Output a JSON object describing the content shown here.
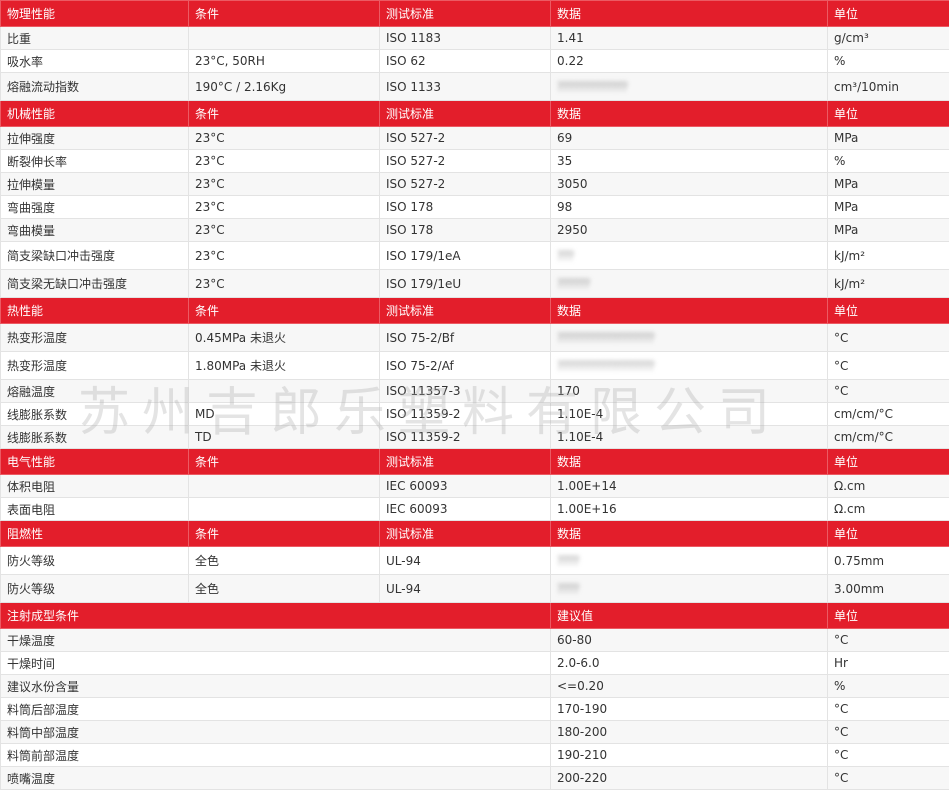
{
  "sections": [
    {
      "header": [
        "物理性能",
        "条件",
        "测试标准",
        "数据",
        "单位"
      ],
      "rows": [
        {
          "name": "比重",
          "cond": "",
          "std": "ISO 1183",
          "data": "1.41",
          "unit": "g/cm³"
        },
        {
          "name": "吸水率",
          "cond": "23°C, 50RH",
          "std": "ISO 62",
          "data": "0.22",
          "unit": "%"
        },
        {
          "name": "熔融流动指数",
          "cond": "190°C / 2.16Kg",
          "std": "ISO 1133",
          "data": "?????????????",
          "blurred": true,
          "unit": "cm³/10min",
          "tall": true
        }
      ]
    },
    {
      "header": [
        "机械性能",
        "条件",
        "测试标准",
        "数据",
        "单位"
      ],
      "rows": [
        {
          "name": "拉伸强度",
          "cond": "23°C",
          "std": "ISO 527-2",
          "data": "69",
          "unit": "MPa"
        },
        {
          "name": "断裂伸长率",
          "cond": "23°C",
          "std": "ISO 527-2",
          "data": "35",
          "unit": "%"
        },
        {
          "name": "拉伸模量",
          "cond": "23°C",
          "std": "ISO 527-2",
          "data": "3050",
          "unit": "MPa"
        },
        {
          "name": "弯曲强度",
          "cond": "23°C",
          "std": "ISO 178",
          "data": "98",
          "unit": "MPa"
        },
        {
          "name": "弯曲模量",
          "cond": "23°C",
          "std": "ISO 178",
          "data": "2950",
          "unit": "MPa"
        },
        {
          "name": "简支梁缺口冲击强度",
          "cond": "23°C",
          "std": "ISO 179/1eA",
          "data": "???",
          "blurred": true,
          "unit": "kJ/m²",
          "tall": true
        },
        {
          "name": "简支梁无缺口冲击强度",
          "cond": "23°C",
          "std": "ISO 179/1eU",
          "data": "??????",
          "blurred": true,
          "unit": "kJ/m²",
          "tall": true
        }
      ]
    },
    {
      "header": [
        "热性能",
        "条件",
        "测试标准",
        "数据",
        "单位"
      ],
      "rows": [
        {
          "name": "热变形温度",
          "cond": "0.45MPa 未退火",
          "std": "ISO 75-2/Bf",
          "data": "??????????????????",
          "blurred": true,
          "unit": "°C",
          "tall": true
        },
        {
          "name": "热变形温度",
          "cond": "1.80MPa 未退火",
          "std": "ISO 75-2/Af",
          "data": "??????????????????",
          "blurred": true,
          "unit": "°C",
          "tall": true
        },
        {
          "name": "熔融温度",
          "cond": "",
          "std": "ISO 11357-3",
          "data": "170",
          "unit": "°C"
        },
        {
          "name": "线膨胀系数",
          "cond": "MD",
          "std": "ISO 11359-2",
          "data": "1.10E-4",
          "unit": "cm/cm/°C"
        },
        {
          "name": "线膨胀系数",
          "cond": "TD",
          "std": "ISO 11359-2",
          "data": "1.10E-4",
          "unit": "cm/cm/°C"
        }
      ]
    },
    {
      "header": [
        "电气性能",
        "条件",
        "测试标准",
        "数据",
        "单位"
      ],
      "rows": [
        {
          "name": "体积电阻",
          "cond": "",
          "std": "IEC 60093",
          "data": "1.00E+14",
          "unit": "Ω.cm"
        },
        {
          "name": "表面电阻",
          "cond": "",
          "std": "IEC 60093",
          "data": "1.00E+16",
          "unit": "Ω.cm"
        }
      ]
    },
    {
      "header": [
        "阻燃性",
        "条件",
        "测试标准",
        "数据",
        "单位"
      ],
      "rows": [
        {
          "name": "防火等级",
          "cond": "全色",
          "std": "UL-94",
          "data": "????",
          "blurred": true,
          "unit": "0.75mm",
          "tall": true
        },
        {
          "name": "防火等级",
          "cond": "全色",
          "std": "UL-94",
          "data": "????",
          "blurred": true,
          "unit": "3.00mm",
          "tall": true
        }
      ]
    }
  ],
  "molding": {
    "header": [
      "注射成型条件",
      "建议值",
      "单位"
    ],
    "rows": [
      {
        "name": "干燥温度",
        "value": "60-80",
        "unit": "°C"
      },
      {
        "name": "干燥时间",
        "value": "2.0-6.0",
        "unit": "Hr"
      },
      {
        "name": "建议水份含量",
        "value": "<=0.20",
        "unit": "%"
      },
      {
        "name": "料筒后部温度",
        "value": "170-190",
        "unit": "°C"
      },
      {
        "name": "料筒中部温度",
        "value": "180-200",
        "unit": "°C"
      },
      {
        "name": "料筒前部温度",
        "value": "190-210",
        "unit": "°C"
      },
      {
        "name": "喷嘴温度",
        "value": "200-220",
        "unit": "°C"
      }
    ]
  },
  "watermark": "苏州吉郎乐塑料有限公司",
  "colors": {
    "header_bg": "#e31e2b",
    "header_text": "#ffffff",
    "row_alt": "#f7f7f7"
  }
}
